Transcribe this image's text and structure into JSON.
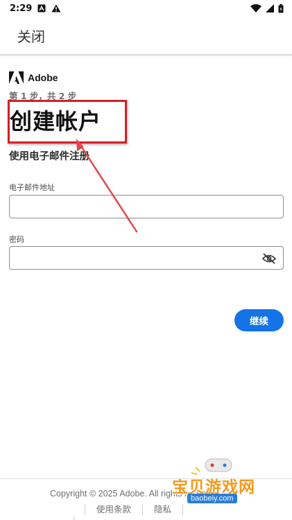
{
  "status_bar": {
    "time": "2:29",
    "icons_left": [
      "notification-a-icon",
      "warning-icon"
    ],
    "icons_right": [
      "wifi-icon",
      "signal-icon",
      "battery-icon"
    ]
  },
  "header": {
    "close_label": "关闭"
  },
  "brand": {
    "name": "Adobe",
    "logo_icon": "adobe-logo-icon"
  },
  "form": {
    "step_text": "第 1 步，共 2 步",
    "title": "创建帐户",
    "subtitle": "使用电子邮件注册",
    "email_label": "电子邮件地址",
    "email_value": "",
    "password_label": "密码",
    "password_value": "",
    "password_toggle_icon": "eye-off-icon",
    "continue_label": "继续"
  },
  "footer": {
    "copyright": "Copyright © 2025 Adobe. All rights reserved.",
    "links": [
      "使用条款",
      "隐私"
    ]
  },
  "annotation": {
    "highlight_color": "#d21f26",
    "arrow_color": "#e0484a"
  },
  "watermark": {
    "text": "宝贝游戏网",
    "url": "baobeiy.com"
  },
  "colors": {
    "accent": "#1473e6"
  }
}
